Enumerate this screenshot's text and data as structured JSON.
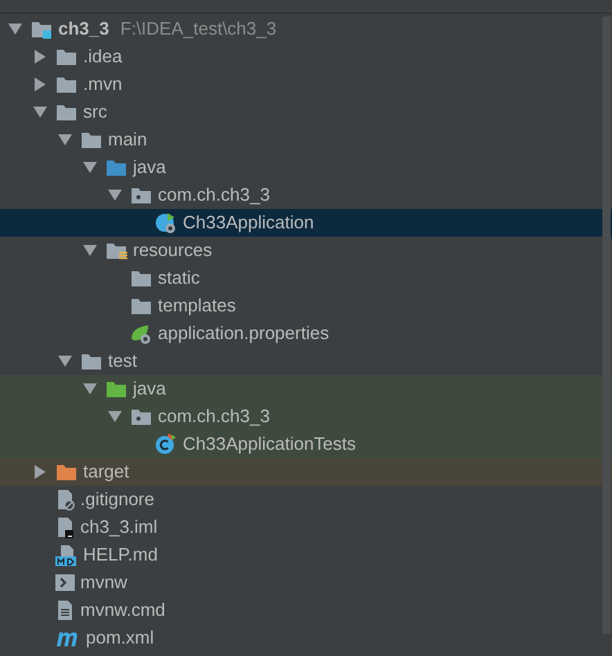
{
  "tree": [
    {
      "label": "ch3_3",
      "path": "F:\\IDEA_test\\ch3_3",
      "kind": "module",
      "expanded": true,
      "selected": false,
      "children": [
        {
          "label": ".idea",
          "kind": "folder",
          "expanded": false,
          "selected": false
        },
        {
          "label": ".mvn",
          "kind": "folder",
          "expanded": false,
          "selected": false
        },
        {
          "label": "src",
          "kind": "folder",
          "expanded": true,
          "selected": false,
          "children": [
            {
              "label": "main",
              "kind": "folder",
              "expanded": true,
              "selected": false,
              "children": [
                {
                  "label": "java",
                  "kind": "source",
                  "expanded": true,
                  "selected": false,
                  "children": [
                    {
                      "label": "com.ch.ch3_3",
                      "kind": "package",
                      "expanded": true,
                      "selected": false,
                      "children": [
                        {
                          "label": "Ch33Application",
                          "kind": "application",
                          "selected": true
                        }
                      ]
                    }
                  ]
                },
                {
                  "label": "resources",
                  "kind": "resources",
                  "expanded": true,
                  "selected": false,
                  "children": [
                    {
                      "label": "static",
                      "kind": "folder",
                      "selected": false
                    },
                    {
                      "label": "templates",
                      "kind": "folder",
                      "selected": false
                    },
                    {
                      "label": "application.properties",
                      "kind": "properties",
                      "selected": false
                    }
                  ]
                }
              ]
            },
            {
              "label": "test",
              "kind": "folder",
              "expanded": true,
              "selected": false,
              "children": [
                {
                  "label": "java",
                  "kind": "testsource",
                  "expanded": true,
                  "selected": false,
                  "children": [
                    {
                      "label": "com.ch.ch3_3",
                      "kind": "testpackage",
                      "expanded": true,
                      "selected": false,
                      "children": [
                        {
                          "label": "Ch33ApplicationTests",
                          "kind": "testclass",
                          "selected": false
                        }
                      ]
                    }
                  ]
                }
              ]
            }
          ]
        },
        {
          "label": "target",
          "kind": "excluded",
          "expanded": false,
          "selected": false
        },
        {
          "label": ".gitignore",
          "kind": "ignore",
          "selected": false
        },
        {
          "label": "ch3_3.iml",
          "kind": "iml",
          "selected": false
        },
        {
          "label": "HELP.md",
          "kind": "markdown",
          "selected": false
        },
        {
          "label": "mvnw",
          "kind": "shell",
          "selected": false
        },
        {
          "label": "mvnw.cmd",
          "kind": "text",
          "selected": false
        },
        {
          "label": "pom.xml",
          "kind": "maven",
          "selected": false
        }
      ]
    }
  ]
}
